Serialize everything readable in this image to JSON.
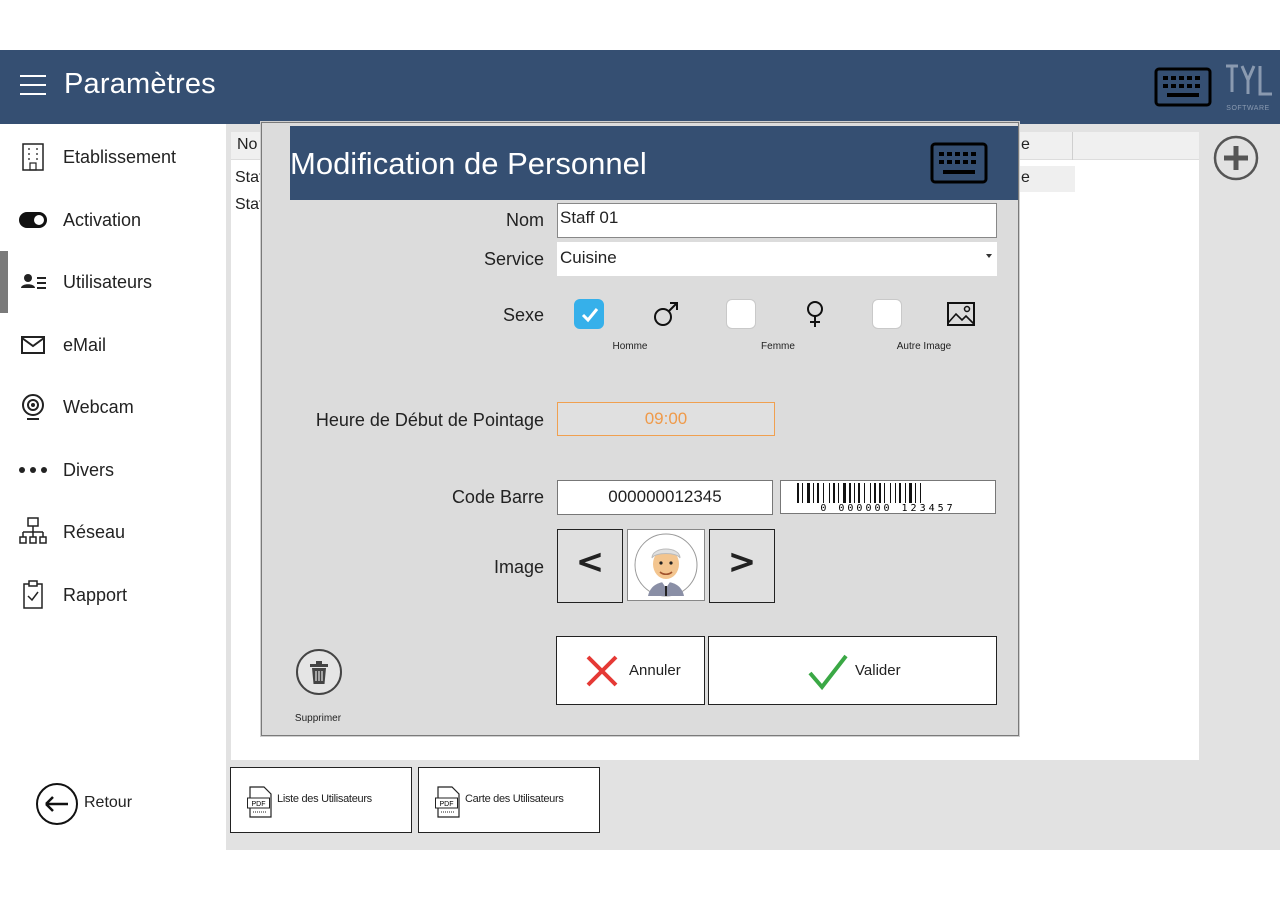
{
  "header": {
    "title": "Paramètres",
    "logo_text": "SOFTWARE"
  },
  "sidebar": {
    "items": [
      {
        "label": "Etablissement",
        "icon": "building-icon"
      },
      {
        "label": "Activation",
        "icon": "toggle-icon"
      },
      {
        "label": "Utilisateurs",
        "icon": "users-icon",
        "active": true
      },
      {
        "label": "eMail",
        "icon": "mail-icon"
      },
      {
        "label": "Webcam",
        "icon": "webcam-icon"
      },
      {
        "label": "Divers",
        "icon": "dots-icon"
      },
      {
        "label": "Réseau",
        "icon": "network-icon"
      },
      {
        "label": "Rapport",
        "icon": "clipboard-icon"
      }
    ],
    "back_label": "Retour"
  },
  "table": {
    "header_left": "No",
    "header_right": "e",
    "rows": [
      {
        "left": "Staf",
        "right": "e"
      },
      {
        "left": "Staf",
        "right": ""
      }
    ]
  },
  "bottom_buttons": {
    "list_label": "Liste des Utilisateurs",
    "card_label": "Carte des Utilisateurs",
    "pdf_text": "PDF"
  },
  "modal": {
    "title": "Modification de Personnel",
    "nom_label": "Nom",
    "nom_value": "Staff 01",
    "service_label": "Service",
    "service_value": "Cuisine",
    "sexe_label": "Sexe",
    "sexe_options": [
      {
        "label": "Homme",
        "checked": true
      },
      {
        "label": "Femme",
        "checked": false
      },
      {
        "label": "Autre Image",
        "checked": false
      }
    ],
    "heure_label": "Heure de Début de Pointage",
    "heure_value": "09:00",
    "code_label": "Code Barre",
    "code_value": "000000012345",
    "barcode_digits": "0 000000 123457",
    "image_label": "Image",
    "prev_label": "<",
    "next_label": ">",
    "cancel_label": "Annuler",
    "validate_label": "Valider",
    "delete_label": "Supprimer"
  },
  "colors": {
    "header_bg": "#354f72",
    "checkbox_accent": "#36b0ea",
    "time_accent": "#ef9a4a",
    "cancel_red": "#e53935",
    "validate_green": "#3aa845"
  }
}
